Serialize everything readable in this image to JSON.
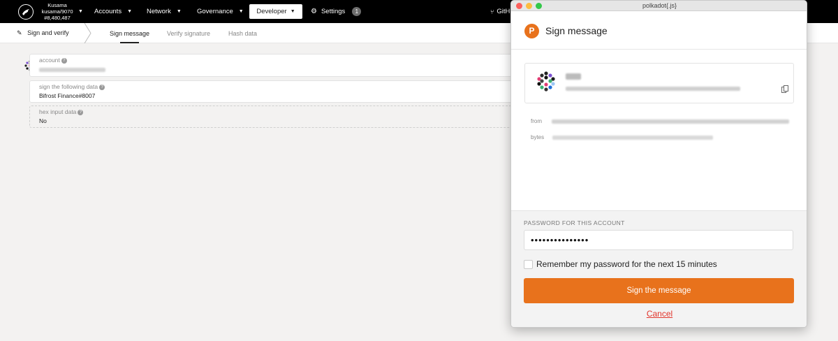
{
  "topbar": {
    "chain_name": "Kusama",
    "chain_version": "kusama/9070",
    "block_number": "#8,480,487",
    "nav": {
      "accounts": "Accounts",
      "network": "Network",
      "governance": "Governance",
      "developer": "Developer",
      "settings": "Settings",
      "settings_badge": "1",
      "github_partial": "GitH"
    }
  },
  "subbar": {
    "section_title": "Sign and verify",
    "tabs": [
      "Sign message",
      "Verify signature",
      "Hash data"
    ]
  },
  "form": {
    "account_label": "account",
    "data_label": "sign the following data",
    "data_value": "Bifrost Finance#8007",
    "hex_label": "hex input data",
    "hex_value": "No"
  },
  "popup": {
    "window_title": "polkadot{.js}",
    "title": "Sign message",
    "from_label": "from",
    "bytes_label": "bytes",
    "password_label": "PASSWORD FOR THIS ACCOUNT",
    "password_value": "•••••••••••••••",
    "remember_label": "Remember my password for the next 15 minutes",
    "remember_checked": false,
    "sign_button": "Sign the message",
    "cancel_link": "Cancel"
  },
  "colors": {
    "accent": "#e8721c",
    "cancel": "#e2342b",
    "topbar_bg": "#000000",
    "page_bg": "#f3f2f1"
  },
  "icons": {
    "chain_logo": "kusama-bird-icon",
    "settings": "gear-icon",
    "github": "github-icon",
    "sign_verify": "signature-icon",
    "help": "question-circle-icon",
    "copy": "copy-icon",
    "polkadot_logo": "polkadot-logo-icon"
  }
}
